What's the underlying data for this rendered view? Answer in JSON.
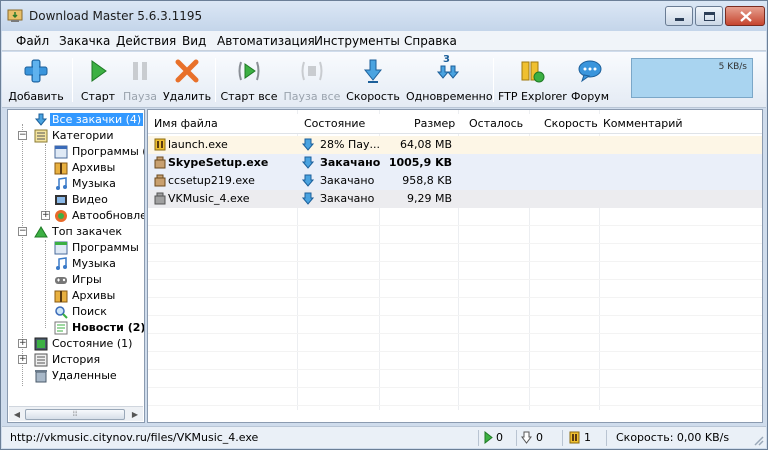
{
  "window": {
    "title": "Download Master 5.6.3.1195"
  },
  "menu": [
    "Файл",
    "Закачка",
    "Действия",
    "Вид",
    "Автоматизация",
    "Инструменты",
    "Справка"
  ],
  "toolbar": {
    "add": "Добавить",
    "start": "Старт",
    "pause": "Пауза",
    "delete": "Удалить",
    "start_all": "Старт все",
    "pause_all": "Пауза все",
    "speed": "Скорость",
    "simultaneous": "Одновременно",
    "simultaneous_badge": "3",
    "ftp": "FTP Explorer",
    "forum": "Форум",
    "speed_graph_label": "5 KB/s"
  },
  "tree": {
    "all": "Все закачки (4)",
    "categories": "Категории",
    "programs": "Программы (4",
    "archives": "Архивы",
    "music": "Музыка",
    "video": "Видео",
    "autoupdate": "Автообновле",
    "top": "Топ закачек",
    "top_programs": "Программы",
    "top_music": "Музыка",
    "top_games": "Игры",
    "top_archives": "Архивы",
    "top_search": "Поиск",
    "top_news": "Новости (2)",
    "status": "Состояние (1)",
    "history": "История",
    "deleted": "Удаленные"
  },
  "list": {
    "headers": {
      "name": "Имя файла",
      "state": "Состояние",
      "size": "Размер",
      "remaining": "Осталось",
      "speed": "Скорость",
      "comment": "Комментарий"
    },
    "rows": [
      {
        "name": "launch.exe",
        "state": "28% Пау...",
        "size": "64,08 MB"
      },
      {
        "name": "SkypeSetup.exe",
        "state": "Закачано",
        "size": "1005,9 KB"
      },
      {
        "name": "ccsetup219.exe",
        "state": "Закачано",
        "size": "958,8 KB"
      },
      {
        "name": "VKMusic_4.exe",
        "state": "Закачано",
        "size": "9,29 MB"
      }
    ]
  },
  "statusbar": {
    "url": "http://vkmusic.citynov.ru/files/VKMusic_4.exe",
    "active": "0",
    "queued": "0",
    "paused": "1",
    "speed": "Скорость: 0,00 KB/s"
  },
  "colors": {
    "selection": "#3399ff",
    "speed_graph": "#a9d4f0",
    "close_button": "#c6452f"
  }
}
